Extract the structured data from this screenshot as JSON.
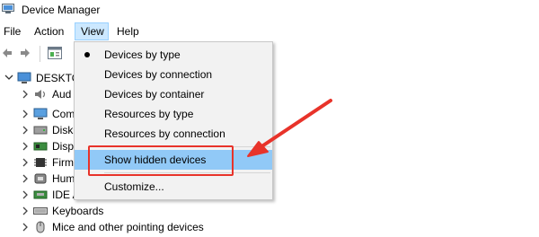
{
  "window": {
    "title": "Device Manager"
  },
  "menubar": {
    "items": [
      "File",
      "Action",
      "View",
      "Help"
    ]
  },
  "tree": {
    "root": "DESKTO",
    "items": [
      "Aud",
      "Com",
      "Disk",
      "Disp",
      "Firm",
      "Hum",
      "IDE A",
      "Keyboards",
      "Mice and other pointing devices"
    ]
  },
  "view_menu": {
    "items": [
      "Devices by type",
      "Devices by connection",
      "Devices by container",
      "Resources by type",
      "Resources by connection",
      "Show hidden devices",
      "Customize..."
    ],
    "selected": "Devices by type",
    "hovered": "Show hidden devices"
  },
  "colors": {
    "annotation_red": "#e8332a",
    "menu_hover": "#91c9f7",
    "menu_active": "#cce8ff"
  },
  "icons": [
    "device-manager-app-icon",
    "back-arrow-icon",
    "forward-arrow-icon",
    "properties-icon"
  ]
}
